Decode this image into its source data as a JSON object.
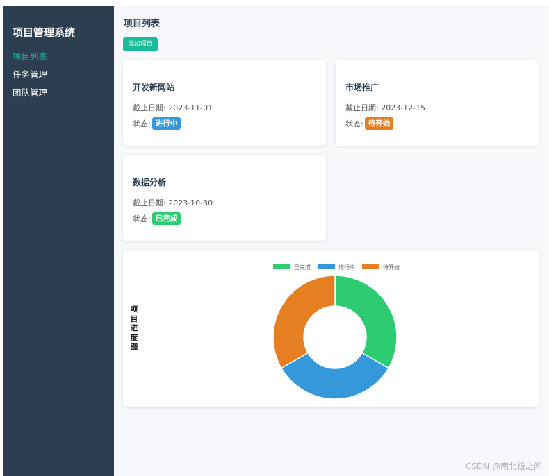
{
  "sidebar": {
    "title": "项目管理系统",
    "items": [
      {
        "label": "项目列表",
        "active": true
      },
      {
        "label": "任务管理",
        "active": false
      },
      {
        "label": "团队管理",
        "active": false
      }
    ]
  },
  "main": {
    "title": "项目列表",
    "add_button": "添加项目",
    "date_prefix": "截止日期: ",
    "status_prefix": "状态:",
    "projects": [
      {
        "name": "开发新网站",
        "due": "2023-11-01",
        "status": "进行中",
        "status_color": "#3498db"
      },
      {
        "name": "市场推广",
        "due": "2023-12-15",
        "status": "待开始",
        "status_color": "#e67e22"
      },
      {
        "name": "数据分析",
        "due": "2023-10-30",
        "status": "已完成",
        "status_color": "#2ecc71"
      }
    ]
  },
  "chart_data": {
    "type": "pie",
    "variant": "doughnut",
    "title": "项目进度图",
    "legend_position": "top",
    "categories": [
      "已完成",
      "进行中",
      "待开始"
    ],
    "values": [
      1,
      1,
      1
    ],
    "colors": [
      "#2ecc71",
      "#3498db",
      "#e67e22"
    ]
  },
  "watermark": "CSDN @南北极之间"
}
